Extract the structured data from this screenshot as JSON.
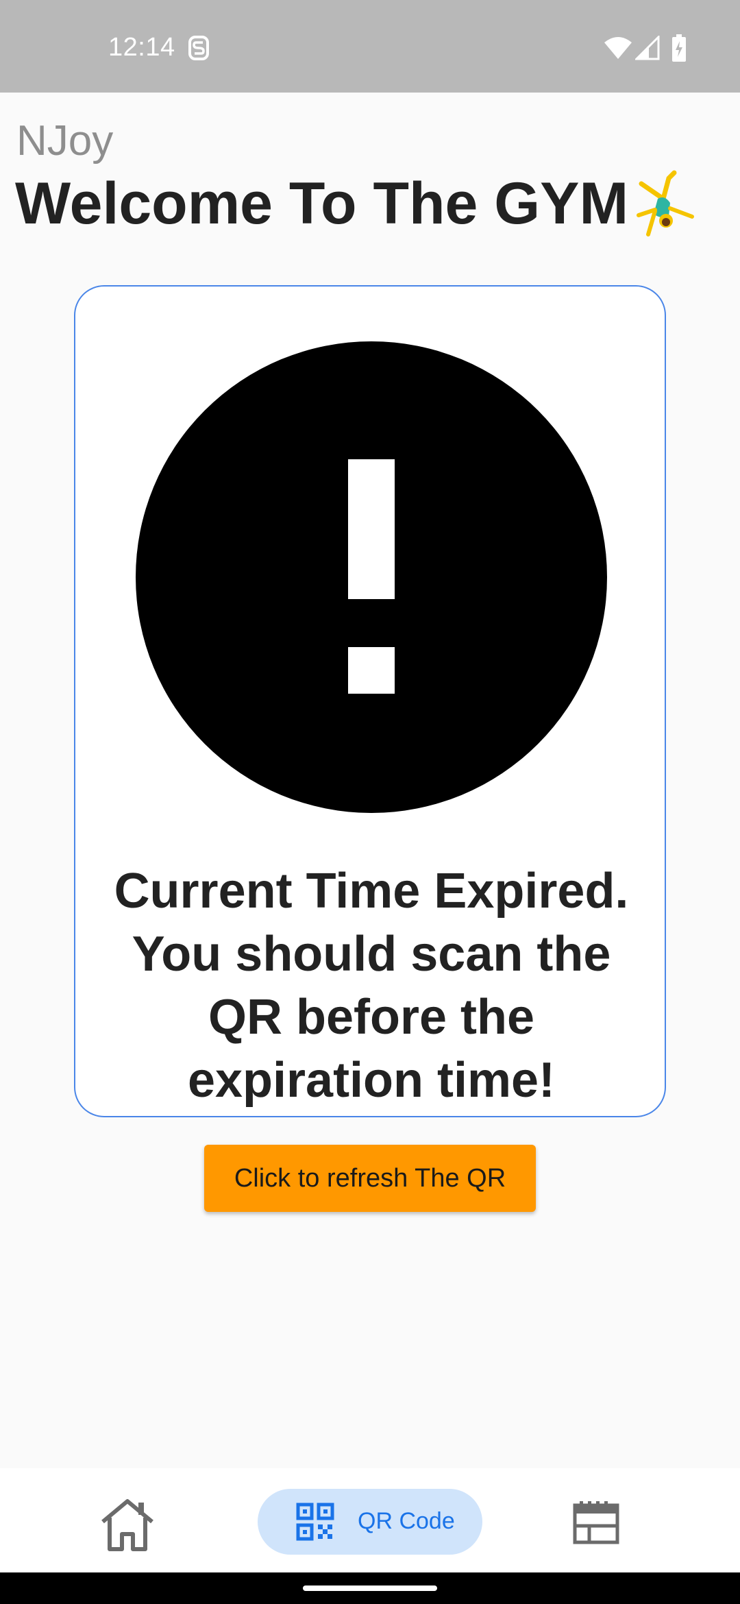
{
  "status_bar": {
    "time": "12:14",
    "icons": [
      "s-notification-icon",
      "wifi-icon",
      "signal-icon",
      "battery-charging-icon"
    ]
  },
  "header": {
    "app_name": "NJoy",
    "title": "Welcome To The GYM",
    "title_icon": "cartwheel-person-icon"
  },
  "card": {
    "icon": "warning-exclamation-icon",
    "message": "Current Time Expired.\n You should scan the QR before the expiration time!"
  },
  "refresh_button": {
    "label": "Click to refresh The QR"
  },
  "bottom_nav": {
    "items": [
      {
        "icon": "home-icon",
        "label": "",
        "selected": false
      },
      {
        "icon": "qr-code-icon",
        "label": "QR Code",
        "selected": true
      },
      {
        "icon": "schedule-icon",
        "label": "",
        "selected": false
      }
    ]
  },
  "colors": {
    "status_bar_bg": "#b8b8b8",
    "page_bg": "#fafafa",
    "card_border": "#4a86e8",
    "button_bg": "#ff9800",
    "nav_selected_bg": "#d0e4fb",
    "nav_selected_fg": "#1a73e8",
    "nav_icon": "#6b6b6b"
  }
}
